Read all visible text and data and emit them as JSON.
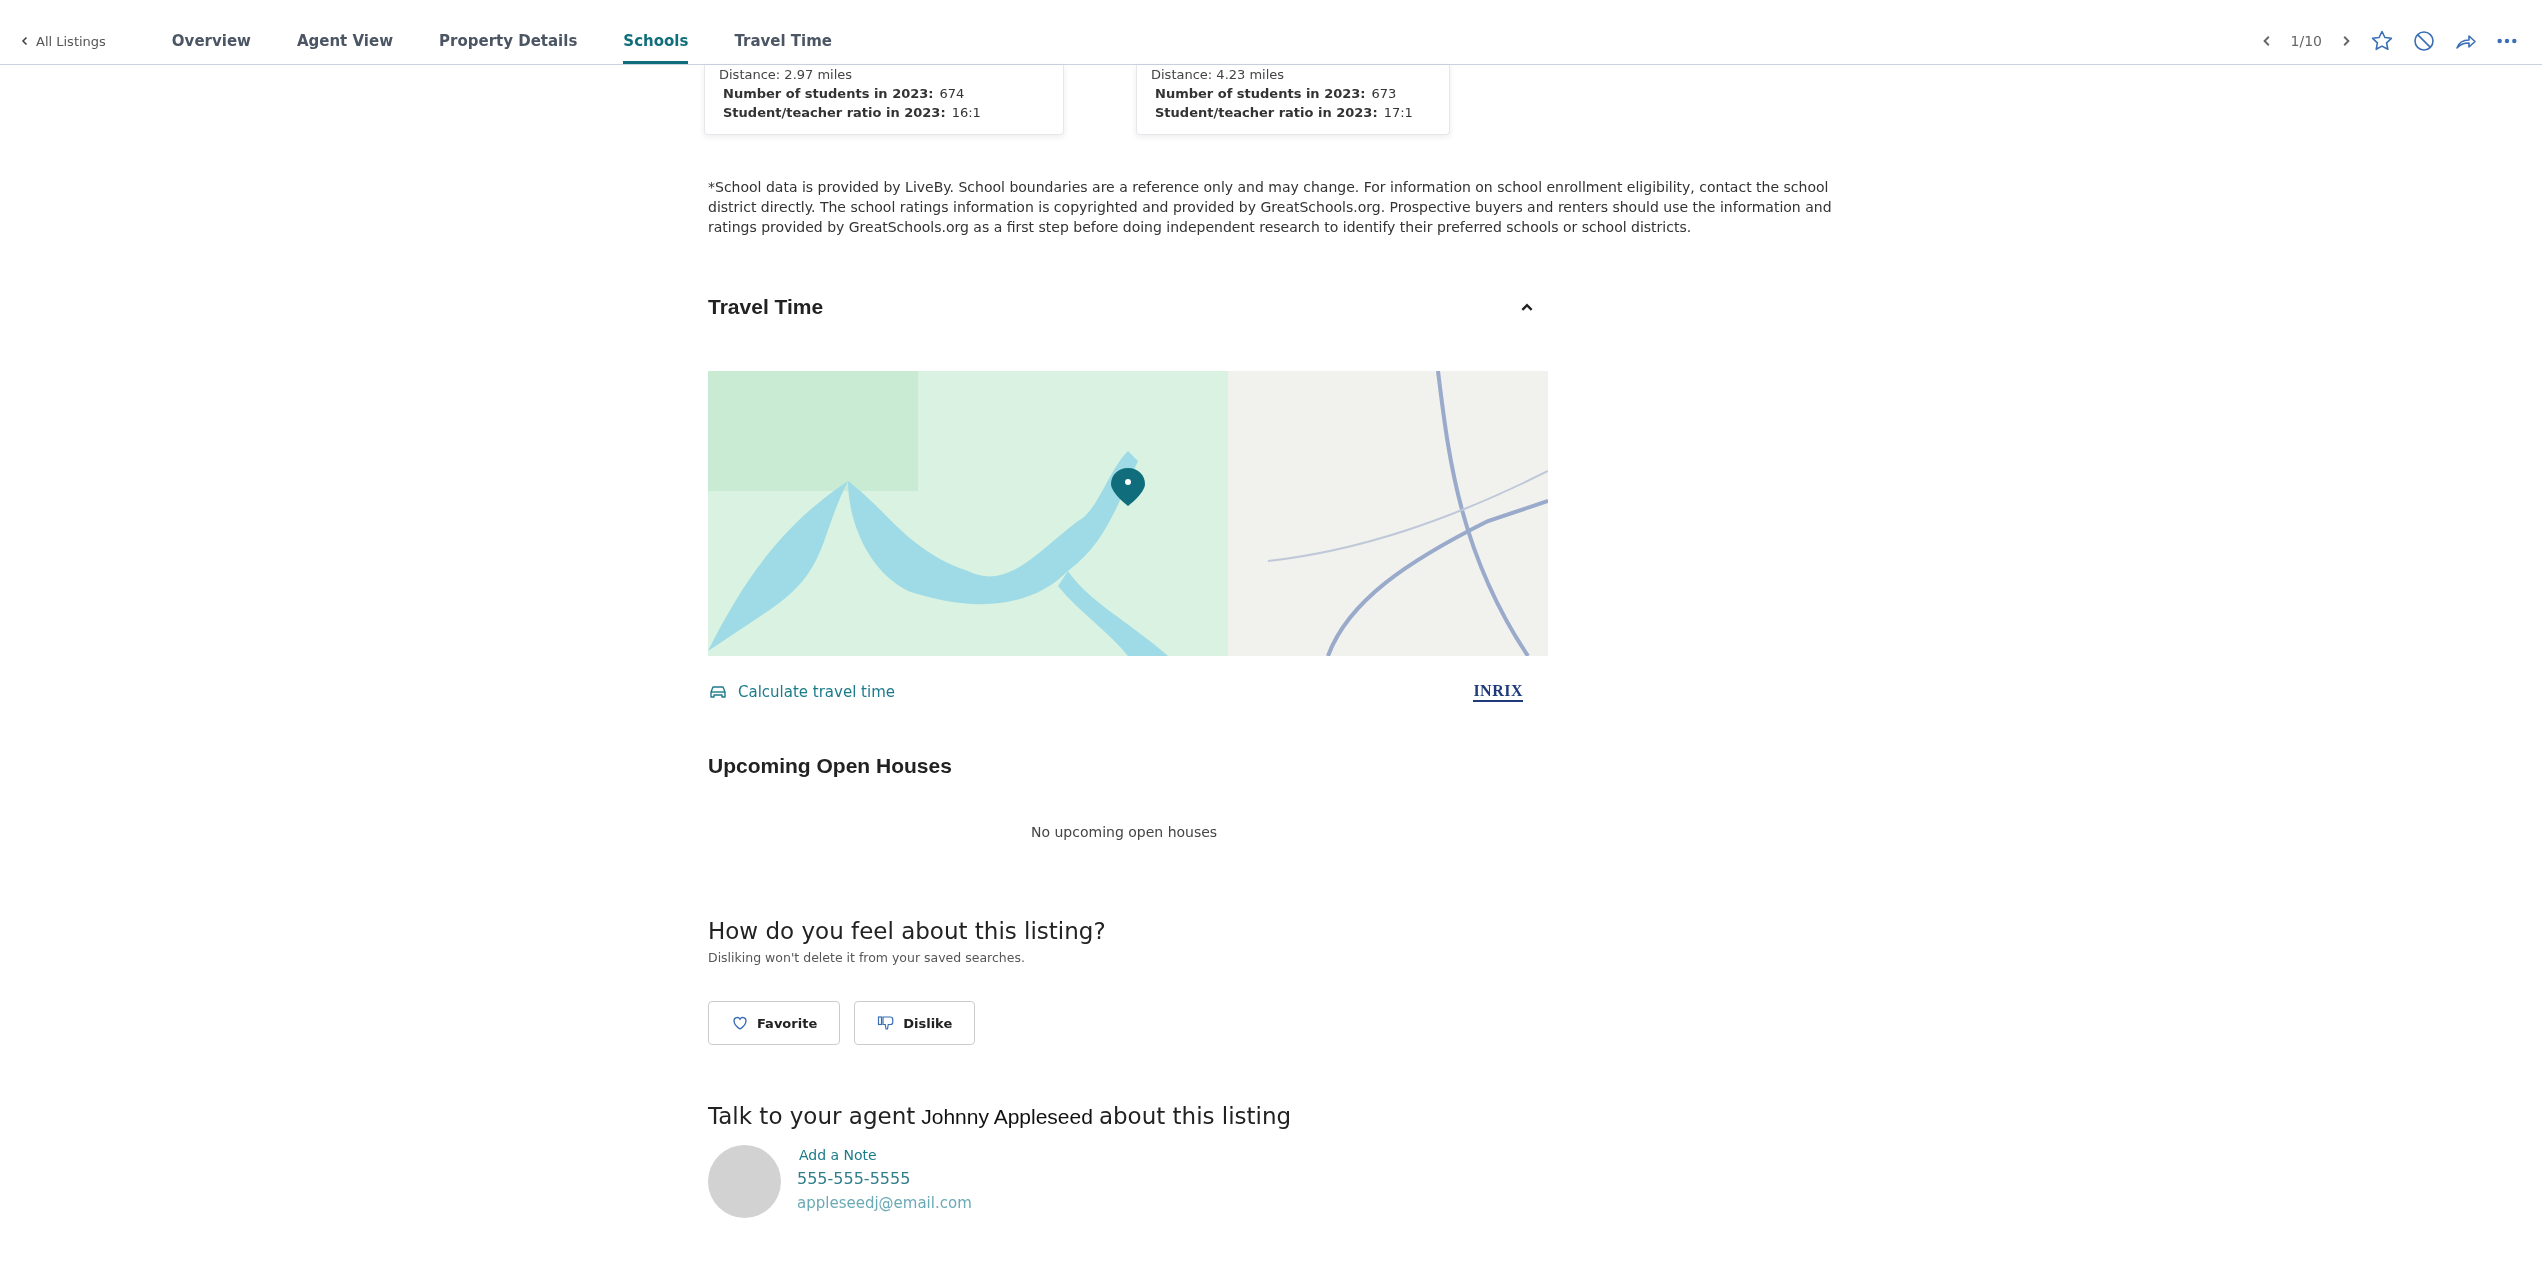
{
  "nav": {
    "back_label": "All Listings",
    "tabs": [
      {
        "label": "Overview",
        "selected": false
      },
      {
        "label": "Agent View",
        "selected": false
      },
      {
        "label": "Property Details",
        "selected": false
      },
      {
        "label": "Schools",
        "selected": true
      },
      {
        "label": "Travel Time",
        "selected": false
      }
    ],
    "pager": "1/10"
  },
  "schools": [
    {
      "distance": "Distance: 2.97 miles",
      "students_label": "Number of students in 2023:",
      "students": "674",
      "ratio_label": "Student/teacher ratio in 2023:",
      "ratio": "16:1"
    },
    {
      "distance": "Distance: 4.23 miles",
      "students_label": "Number of students in 2023:",
      "students": "673",
      "ratio_label": "Student/teacher ratio in 2023:",
      "ratio": "17:1"
    }
  ],
  "disclaimer": "*School data is provided by LiveBy. School boundaries are a reference only and may change. For information on school enrollment eligibility, contact the school district directly. The school ratings information is copyrighted and provided by GreatSchools.org. Prospective buyers and renters should use the information and ratings provided by GreatSchools.org as a first step before doing independent research to identify their preferred schools or school districts.",
  "travel_time": {
    "title": "Travel Time",
    "expanded": true,
    "calculate_link": "Calculate travel time",
    "provider_logo": "INRIX"
  },
  "open_houses": {
    "title": "Upcoming Open Houses",
    "empty_message": "No upcoming open houses"
  },
  "feedback": {
    "title": "How do you feel about this listing?",
    "subtitle": "Disliking won't delete it from your saved searches.",
    "buttons": [
      {
        "kind": "favorite",
        "label": "Favorite"
      },
      {
        "kind": "dislike",
        "label": "Dislike"
      }
    ]
  },
  "agent": {
    "title_before": "Talk to your agent",
    "name": "Johnny Appleseed",
    "title_after": "about this listing",
    "add_note": "Add a Note",
    "phone": "555-555-5555",
    "email": "appleseedj@email.com"
  }
}
